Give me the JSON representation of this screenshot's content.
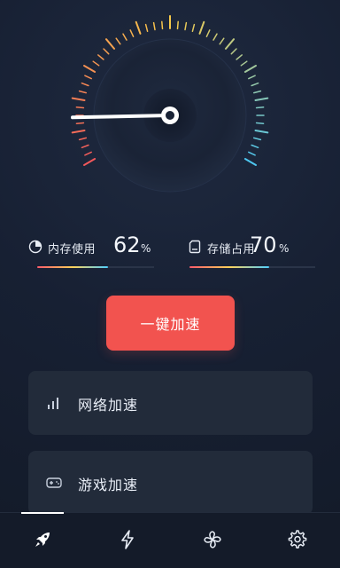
{
  "gauge": {
    "needle_value": 0.12,
    "colors": [
      "#f4585b",
      "#f6c94a",
      "#4ec7f0"
    ]
  },
  "stats": {
    "memory": {
      "label": "内存使用",
      "value": "62",
      "unit": "%",
      "icon": "pie-chart-icon",
      "fill": 0.62
    },
    "storage": {
      "label": "存储占用",
      "value": "70",
      "unit": "%",
      "icon": "sd-card-icon",
      "fill": 0.7
    }
  },
  "boost_button": {
    "label": "一键加速"
  },
  "cards": [
    {
      "label": "网络加速",
      "icon": "signal-bars-icon"
    },
    {
      "label": "游戏加速",
      "icon": "gamepad-icon"
    }
  ],
  "nav": {
    "tabs": [
      {
        "icon": "rocket-icon",
        "active": true
      },
      {
        "icon": "lightning-icon",
        "active": false
      },
      {
        "icon": "fan-icon",
        "active": false
      },
      {
        "icon": "gear-icon",
        "active": false
      }
    ]
  },
  "colors": {
    "background": "#141c2b",
    "card": "#222b3a",
    "accent": "#f2534f"
  }
}
